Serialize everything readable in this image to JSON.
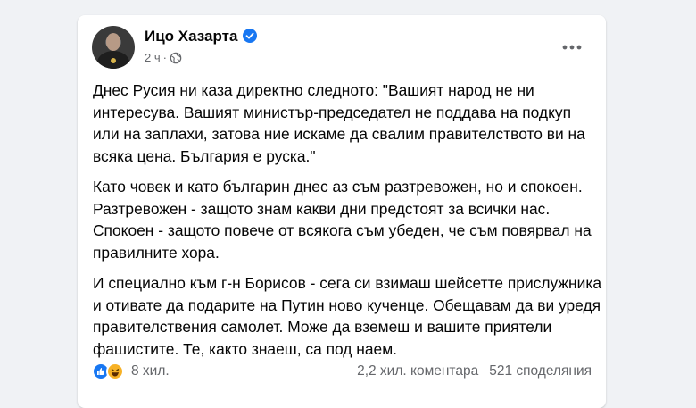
{
  "post": {
    "author": "Ицо Хазарта",
    "time": "2 ч",
    "paragraphs": [
      "Днес Русия ни каза директно следното: \"Вашият народ не ни интересува. Вашият министър-председател не поддава на подкуп или на заплахи, затова ние искаме да свалим правителството ви на всяка цена. България е руска.\"",
      "Като човек и като българин днес аз съм разтревожен, но и спокоен. Разтревожен - защото знам какви дни предстоят за всички нас. Спокоен - защото повече от всякога съм убеден, че съм повярвал на правилните хора.",
      "И специално към г-н Борисов - сега си взимаш шейсетте прислужника и отивате да подарите на Путин ново кученце. Обещавам да ви уредя правителствения самолет. Може да вземеш и вашите приятели фашистите. Те, както знаеш, са под наем."
    ]
  },
  "engagement": {
    "reactions_count": "8 хил.",
    "comments": "2,2 хил. коментара",
    "shares": "521 споделяния"
  },
  "icons": {
    "verified": "verified-badge-icon",
    "audience": "globe-icon",
    "more": "more-options-icon",
    "like": "like-reaction-icon",
    "haha": "haha-reaction-icon"
  },
  "colors": {
    "accent": "#1877f2",
    "text": "#050505",
    "secondary": "#65676b",
    "background": "#f0f2f5"
  }
}
